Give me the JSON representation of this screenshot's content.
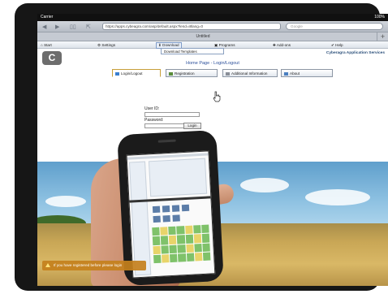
{
  "statusbar": {
    "carrier": "Carrier",
    "battery": "100%"
  },
  "browser": {
    "url": "https://apps.cybeagra.com/asp/default.aspx?lend=i8lang=0",
    "search_placeholder": "Google",
    "tab_title": "Untitled",
    "new_tab": "+",
    "back_icon": "back-arrow-icon",
    "forward_icon": "forward-arrow-icon"
  },
  "menu": {
    "items": [
      {
        "label": "Start",
        "icon": "home-icon"
      },
      {
        "label": "Settings",
        "icon": "gear-icon"
      },
      {
        "label": "Download",
        "icon": "download-icon"
      },
      {
        "label": "Programs",
        "icon": "programs-icon"
      },
      {
        "label": "Add-ons",
        "icon": "puzzle-icon"
      },
      {
        "label": "Help",
        "icon": "help-icon"
      }
    ],
    "dropdown_item": "Download Templates"
  },
  "site": {
    "logo": "C",
    "service_name": "Cyberagra Application Services",
    "page_title": "Home Page - Login/Logout"
  },
  "tabs": [
    {
      "label": "Login/Logout",
      "selected": true
    },
    {
      "label": "Registration",
      "selected": false
    },
    {
      "label": "Additional Information",
      "selected": false
    },
    {
      "label": "About",
      "selected": false
    }
  ],
  "login": {
    "user_label": "User ID:",
    "user_value": "",
    "password_label": "Password:",
    "password_value": "",
    "button": "Login"
  },
  "toast": "If you have registered before please login",
  "colors": {
    "accent": "#2b4f9a",
    "toast_bg": "#c4801c",
    "menu_active": "#7f9cc8"
  }
}
